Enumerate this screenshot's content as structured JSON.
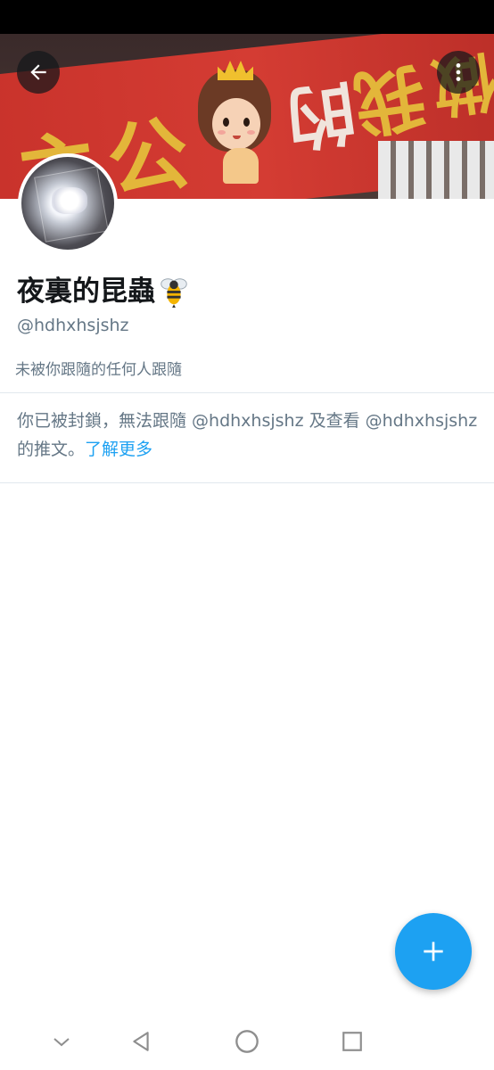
{
  "profile": {
    "display_name": "夜裏的昆蟲",
    "name_emoji": "bee",
    "handle": "@hdhxhsjshz",
    "followers_note": "未被你跟隨的任何人跟隨"
  },
  "banner": {
    "chars": [
      "主",
      "公",
      "的",
      "我",
      "做"
    ]
  },
  "blocked": {
    "message": "你已被封鎖，無法跟隨 @hdhxhsjshz 及查看 @hdhxhsjshz 的推文。",
    "learn_more": "了解更多"
  },
  "icons": {
    "back": "back-arrow-icon",
    "more": "more-vertical-icon",
    "compose": "plus-icon",
    "nav": [
      "chevron-down-icon",
      "back-triangle-icon",
      "home-circle-icon",
      "recents-square-icon"
    ]
  },
  "colors": {
    "accent": "#1da1f2",
    "secondary_text": "#657786",
    "primary_text": "#14171a",
    "divider": "#e1e8ed"
  }
}
